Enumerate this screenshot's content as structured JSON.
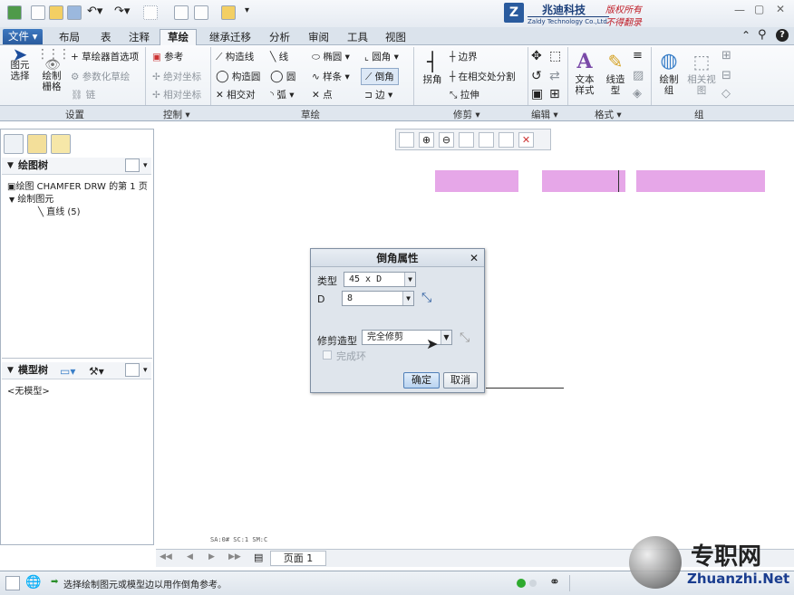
{
  "brand": {
    "company_cn": "兆迪科技",
    "company_en": "Zaldy Technology Co.,Ltd.",
    "copyright1": "版权所有",
    "copyright2": "不得翻录"
  },
  "tabs": [
    "布局",
    "表",
    "注释",
    "草绘",
    "继承迁移",
    "分析",
    "审阅",
    "工具",
    "视图"
  ],
  "file_tab": "文件",
  "ribbon": {
    "settings": {
      "select": "图元\n选择",
      "grid": "绘制\n栅格",
      "sketcher_pref": "草绘器首选项",
      "param_sketch": "参数化草绘",
      "chain": "链"
    },
    "control": {
      "reference": "参考",
      "abs_coord": "绝对坐标",
      "rel_coord": "相对坐标"
    },
    "sketch": {
      "constr_line": "构造线",
      "constr_circle": "构造圆",
      "intersect": "相交对",
      "line": "线",
      "circle": "圆",
      "arc": "弧",
      "ellipse": "椭圆",
      "spline": "样条",
      "point": "点",
      "fillet": "圆角",
      "chamfer": "倒角",
      "edge": "边"
    },
    "trim": {
      "corner": "拐角",
      "boundary": "边界",
      "split": "在相交处分割",
      "stretch": "拉伸"
    },
    "format": {
      "text_style": "文本\n样式",
      "line_style": "线造\n型"
    },
    "group": {
      "draw_group": "绘制\n组",
      "relative_view": "相关视\n图"
    }
  },
  "groups": [
    "设置",
    "控制",
    "草绘",
    "修剪",
    "编辑",
    "格式",
    "组"
  ],
  "left_panel": {
    "draw_tree": "绘图树",
    "tree_root": "绘图 CHAMFER DRW 的第 1 页",
    "sketched_items": "绘制图元",
    "lines": "直线 (5)",
    "model_tree": "模型树",
    "no_model": "<无模型>"
  },
  "dialog": {
    "title": "倒角属性",
    "type_label": "类型",
    "type_value": "45 x D",
    "d_label": "D",
    "d_value": "8",
    "trim_label": "修剪造型",
    "trim_value": "完全修剪",
    "complete_loop": "完成环",
    "ok": "确定",
    "cancel": "取消"
  },
  "page": {
    "label": "页面 1",
    "coords": "SA:0# SC:1 SM:C"
  },
  "status": {
    "message": "选择绘制图元或模型边以用作倒角参考。"
  },
  "watermark": {
    "cn": "专职网",
    "en": "Zhuanzhi.Net"
  },
  "colors": {
    "accent": "#2a5b9e",
    "brand_red": "#c0202a",
    "pixelated": "#e6a7e8"
  }
}
